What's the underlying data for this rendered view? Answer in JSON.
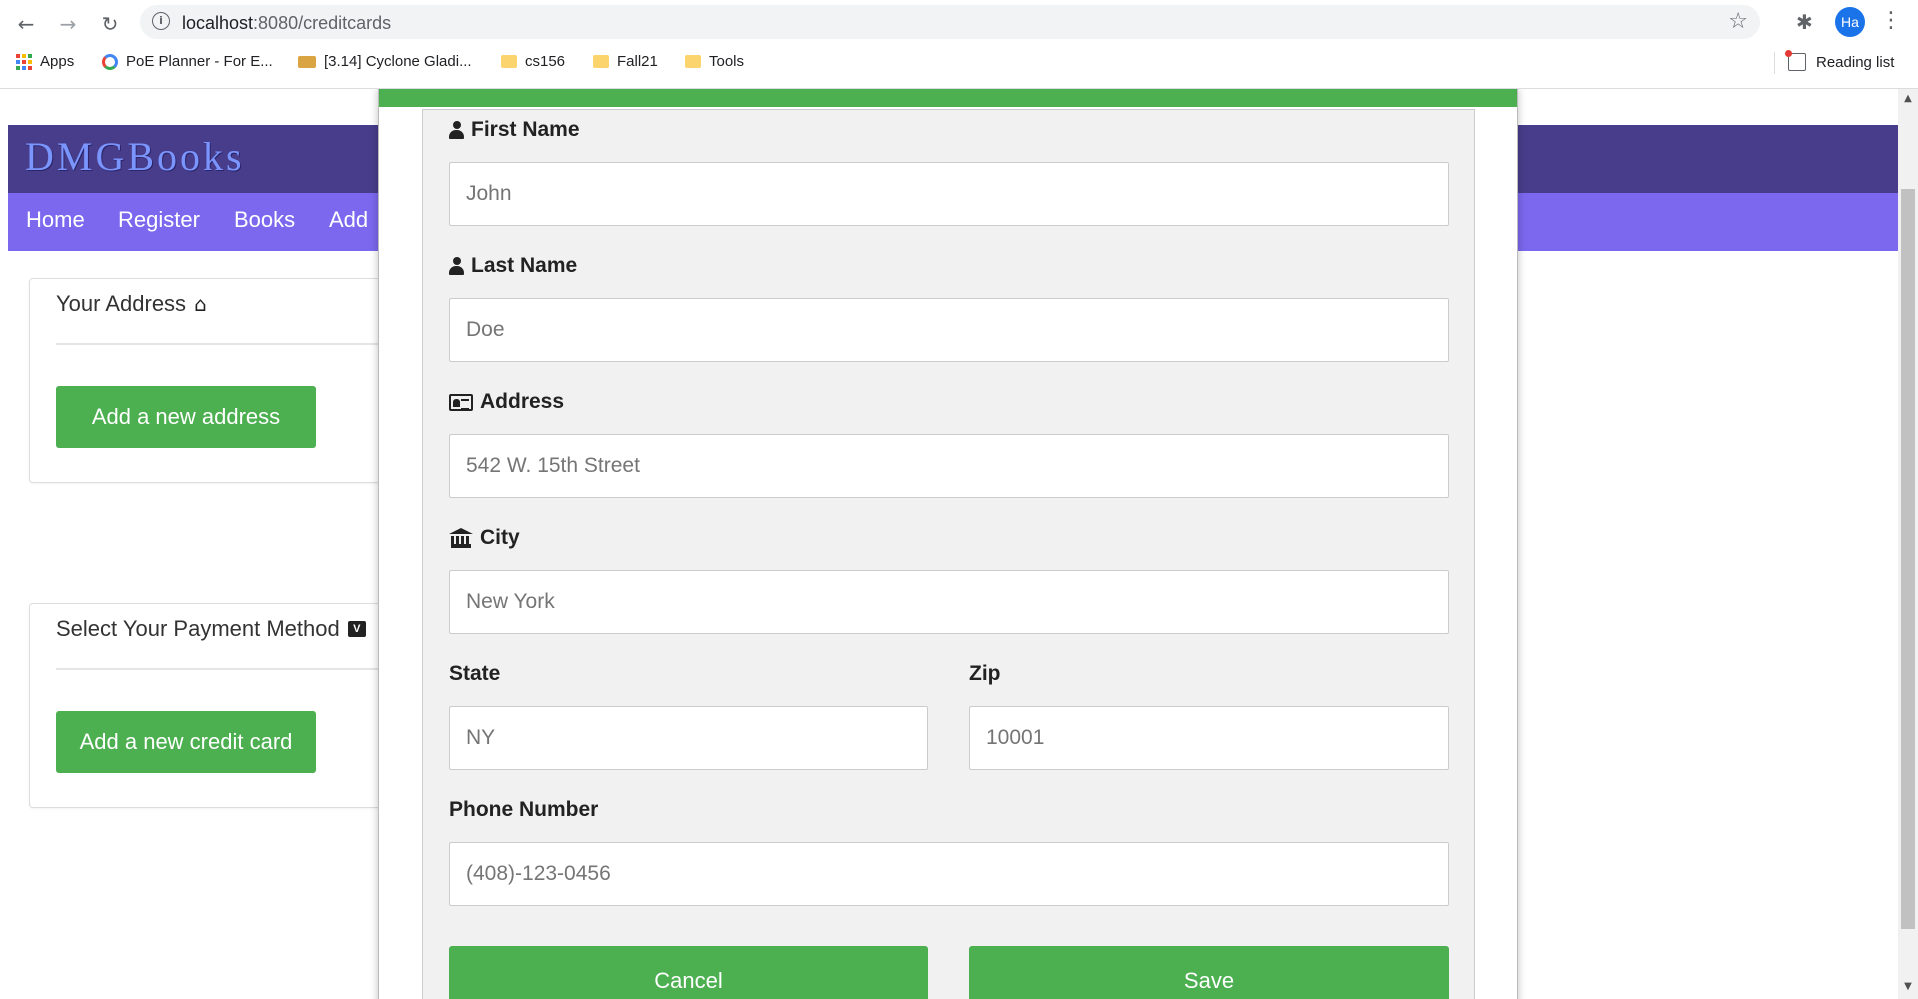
{
  "browser": {
    "back_icon": "←",
    "forward_icon": "→",
    "reload_icon": "↻",
    "info_icon": "i",
    "url_host": "localhost",
    "url_path": ":8080/creditcards",
    "star_icon": "☆",
    "extensions_icon": "✱",
    "profile_initials": "Ha",
    "menu_icon": "⋮",
    "bookmarks": [
      {
        "label": "Apps"
      },
      {
        "label": "PoE Planner - For E..."
      },
      {
        "label": "[3.14] Cyclone Gladi..."
      },
      {
        "label": "cs156"
      },
      {
        "label": "Fall21"
      },
      {
        "label": "Tools"
      }
    ],
    "reading_list": "Reading list"
  },
  "site": {
    "brand": "DMGBooks",
    "nav": [
      "Home",
      "Register",
      "Books",
      "Add"
    ]
  },
  "address_panel": {
    "title": "Your Address",
    "icon": "⌂",
    "button": "Add a new address"
  },
  "payment_panel": {
    "title": "Select Your Payment Method",
    "card_badge": "V",
    "button": "Add a new credit card"
  },
  "form": {
    "first_name": {
      "label": "First Name",
      "placeholder": "John"
    },
    "last_name": {
      "label": "Last Name",
      "placeholder": "Doe"
    },
    "address": {
      "label": "Address",
      "placeholder": "542 W. 15th Street"
    },
    "city": {
      "label": "City",
      "placeholder": "New York"
    },
    "state": {
      "label": "State",
      "placeholder": "NY"
    },
    "zip": {
      "label": "Zip",
      "placeholder": "10001"
    },
    "phone": {
      "label": "Phone Number",
      "placeholder": "(408)-123-0456"
    },
    "cancel": "Cancel",
    "save": "Save"
  },
  "colors": {
    "brand_bar": "#483D8B",
    "nav_bar": "#7B68EE",
    "accent_green": "#4CAF50"
  }
}
